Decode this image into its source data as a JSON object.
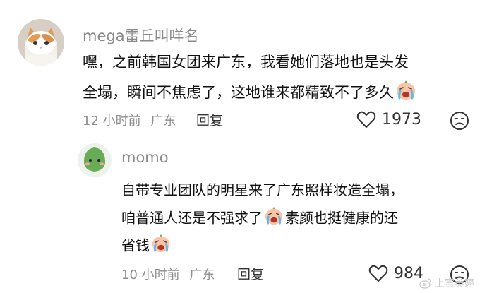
{
  "comment1": {
    "username": "mega雷丘叫咩名",
    "lines": [
      "嘿，之前韩国女团来广东，我看她们落地也是头发",
      "全塌，瞬间不焦虑了，这地谁来都精致不了多久"
    ],
    "time": "12 小时前",
    "location": "广东",
    "reply_label": "回复",
    "like_count": "1973",
    "avatar_icon": "cat-avatar",
    "emojis": [
      "crying-face-icon"
    ]
  },
  "comment2": {
    "username": "momo",
    "lines": [
      "自带专业团队的明星来了广东照样妆造全塌，",
      "咱普通人还是不强求了",
      "素颜也挺健康的还",
      "省钱"
    ],
    "time": "10 小时前",
    "location": "广东",
    "reply_label": "回复",
    "like_count": "984",
    "avatar_icon": "green-creature-avatar",
    "emojis": [
      "crying-face-icon",
      "crying-face-icon"
    ]
  },
  "watermark": "上官美婷",
  "colors": {
    "name": "#8a8a8a",
    "text": "#111111",
    "meta": "#8e8e8e"
  }
}
